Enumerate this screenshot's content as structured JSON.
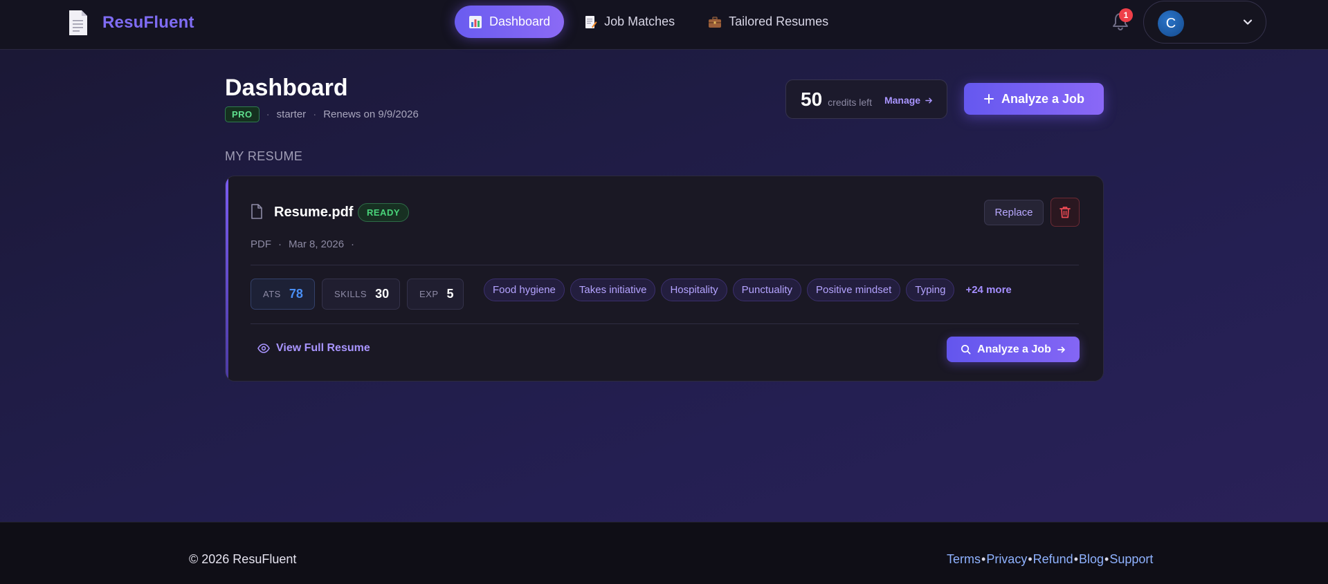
{
  "brand": {
    "name": "ResuFluent"
  },
  "nav": {
    "tabs": [
      {
        "label": "Dashboard",
        "icon": "bar-chart-icon",
        "active": true
      },
      {
        "label": "Job Matches",
        "icon": "memo-icon",
        "active": false
      },
      {
        "label": "Tailored Resumes",
        "icon": "briefcase-icon",
        "active": false
      }
    ],
    "notifications": {
      "count": "1"
    },
    "user": {
      "initial": "C"
    }
  },
  "header": {
    "title": "Dashboard",
    "plan_badge": "PRO",
    "plan_name": "starter",
    "renewal": "Renews on 9/9/2026",
    "credits": {
      "value": "50",
      "label": "credits left",
      "manage": "Manage"
    },
    "analyze_button": "Analyze a Job"
  },
  "resume_section": {
    "heading": "MY RESUME",
    "file_name": "Resume.pdf",
    "status": "READY",
    "file_type": "PDF",
    "date": "Mar 8, 2026",
    "replace_label": "Replace",
    "stats": [
      {
        "label": "ATS",
        "value": "78"
      },
      {
        "label": "SKILLS",
        "value": "30"
      },
      {
        "label": "EXP",
        "value": "5"
      }
    ],
    "skills": [
      "Food hygiene",
      "Takes initiative",
      "Hospitality",
      "Punctuality",
      "Positive mindset",
      "Typing"
    ],
    "more_skills": "+24 more",
    "view_full": "View Full Resume",
    "analyze_button": "Analyze a Job"
  },
  "footer": {
    "copyright": "© 2026 ResuFluent",
    "links": [
      "Terms",
      "Privacy",
      "Refund",
      "Blog",
      "Support"
    ],
    "separator": "•"
  },
  "colors": {
    "accent": "#7c5cf5",
    "success": "#49d47a",
    "danger": "#ef3f49",
    "ats_blue": "#4a8ff5"
  }
}
